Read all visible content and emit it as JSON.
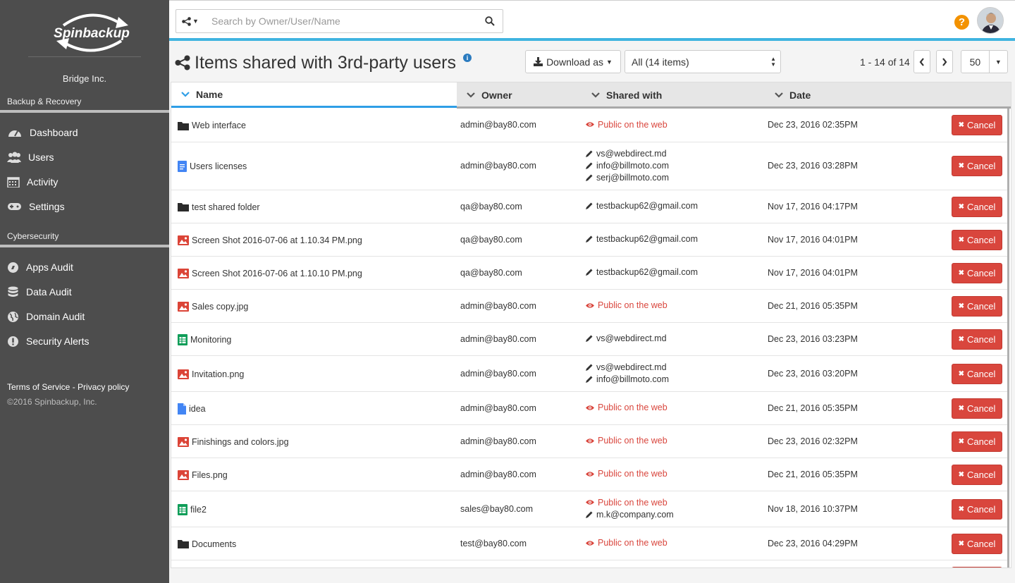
{
  "sidebar": {
    "logo_text": "Spinbackup",
    "org_name": "Bridge Inc.",
    "section_backup": "Backup & Recovery",
    "section_cyber": "Cybersecurity",
    "items": [
      {
        "label": "Dashboard",
        "icon": "dashboard-icon"
      },
      {
        "label": "Users",
        "icon": "users-icon"
      },
      {
        "label": "Activity",
        "icon": "calendar-icon"
      },
      {
        "label": "Settings",
        "icon": "gamepad-icon"
      },
      {
        "label": "Apps Audit",
        "icon": "compass-icon"
      },
      {
        "label": "Data Audit",
        "icon": "database-icon"
      },
      {
        "label": "Domain Audit",
        "icon": "globe-icon"
      },
      {
        "label": "Security Alerts",
        "icon": "exclamation-icon"
      }
    ],
    "terms": "Terms of Service",
    "separator": "-",
    "privacy": "Privacy policy",
    "copyright": "©2016 Spinbackup, Inc."
  },
  "topbar": {
    "search_placeholder": "Search by Owner/User/Name",
    "help": "?"
  },
  "header": {
    "title": "Items shared with 3rd-party users",
    "info": "i",
    "download_label": "Download as",
    "filter_value": "All (14 items)",
    "pager_text": "1 - 14 of 14",
    "per_page": "50"
  },
  "table": {
    "columns": [
      "Name",
      "Owner",
      "Shared with",
      "Date"
    ],
    "cancel_label": "Cancel",
    "rows": [
      {
        "name": "Web interface",
        "type": "folder",
        "owner": "admin@bay80.com",
        "shared": [
          {
            "kind": "public",
            "text": "Public on the web"
          }
        ],
        "date": "Dec 23, 2016 02:35PM"
      },
      {
        "name": "Users licenses",
        "type": "doc",
        "owner": "admin@bay80.com",
        "shared": [
          {
            "kind": "user",
            "text": "vs@webdirect.md"
          },
          {
            "kind": "user",
            "text": "info@billmoto.com"
          },
          {
            "kind": "user",
            "text": "serj@billmoto.com"
          }
        ],
        "date": "Dec 23, 2016 03:28PM"
      },
      {
        "name": "test shared folder",
        "type": "folder",
        "owner": "qa@bay80.com",
        "shared": [
          {
            "kind": "user",
            "text": "testbackup62@gmail.com"
          }
        ],
        "date": "Nov 17, 2016 04:17PM"
      },
      {
        "name": "Screen Shot 2016-07-06 at 1.10.34 PM.png",
        "type": "image",
        "owner": "qa@bay80.com",
        "shared": [
          {
            "kind": "user",
            "text": "testbackup62@gmail.com"
          }
        ],
        "date": "Nov 17, 2016 04:01PM"
      },
      {
        "name": "Screen Shot 2016-07-06 at 1.10.10 PM.png",
        "type": "image",
        "owner": "qa@bay80.com",
        "shared": [
          {
            "kind": "user",
            "text": "testbackup62@gmail.com"
          }
        ],
        "date": "Nov 17, 2016 04:01PM"
      },
      {
        "name": "Sales copy.jpg",
        "type": "image",
        "owner": "admin@bay80.com",
        "shared": [
          {
            "kind": "public",
            "text": "Public on the web"
          }
        ],
        "date": "Dec 21, 2016 05:35PM"
      },
      {
        "name": "Monitoring",
        "type": "sheet",
        "owner": "admin@bay80.com",
        "shared": [
          {
            "kind": "user",
            "text": "vs@webdirect.md"
          }
        ],
        "date": "Dec 23, 2016 03:23PM"
      },
      {
        "name": "Invitation.png",
        "type": "image",
        "owner": "admin@bay80.com",
        "shared": [
          {
            "kind": "user",
            "text": "vs@webdirect.md"
          },
          {
            "kind": "user",
            "text": "info@billmoto.com"
          }
        ],
        "date": "Dec 23, 2016 03:20PM"
      },
      {
        "name": "idea",
        "type": "file",
        "owner": "admin@bay80.com",
        "shared": [
          {
            "kind": "public",
            "text": "Public on the web"
          }
        ],
        "date": "Dec 21, 2016 05:35PM"
      },
      {
        "name": "Finishings and colors.jpg",
        "type": "image",
        "owner": "admin@bay80.com",
        "shared": [
          {
            "kind": "public",
            "text": "Public on the web"
          }
        ],
        "date": "Dec 23, 2016 02:32PM"
      },
      {
        "name": "Files.png",
        "type": "image",
        "owner": "admin@bay80.com",
        "shared": [
          {
            "kind": "public",
            "text": "Public on the web"
          }
        ],
        "date": "Dec 21, 2016 05:35PM"
      },
      {
        "name": "file2",
        "type": "sheet",
        "owner": "sales@bay80.com",
        "shared": [
          {
            "kind": "public",
            "text": "Public on the web"
          },
          {
            "kind": "user",
            "text": "m.k@company.com"
          }
        ],
        "date": "Nov 18, 2016 10:37PM"
      },
      {
        "name": "Documents",
        "type": "folder",
        "owner": "test@bay80.com",
        "shared": [
          {
            "kind": "public",
            "text": "Public on the web"
          }
        ],
        "date": "Dec 23, 2016 04:29PM"
      }
    ]
  },
  "colors": {
    "sidebar_bg": "#4d4d4d",
    "accent_blue": "#40b4e0",
    "danger_red": "#d9463d",
    "help_orange": "#f39200"
  }
}
